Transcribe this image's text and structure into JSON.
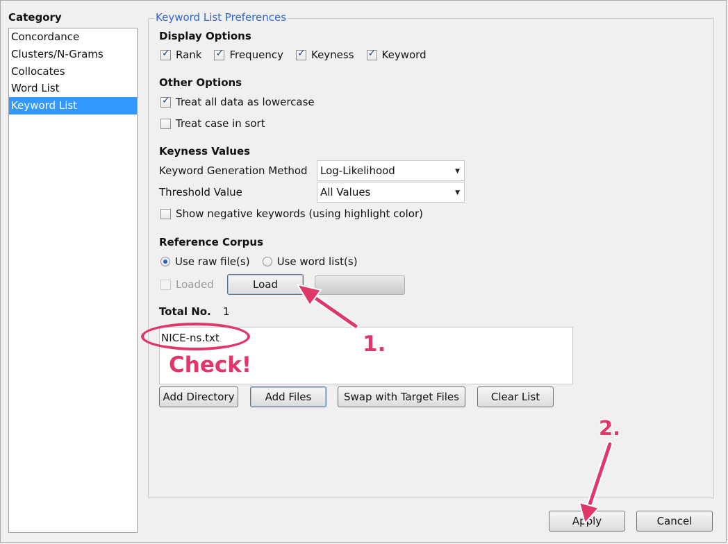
{
  "category": {
    "header": "Category",
    "items": [
      {
        "label": "Concordance",
        "selected": false
      },
      {
        "label": "Clusters/N-Grams",
        "selected": false
      },
      {
        "label": "Collocates",
        "selected": false
      },
      {
        "label": "Word List",
        "selected": false
      },
      {
        "label": "Keyword List",
        "selected": true
      }
    ]
  },
  "panel": {
    "title": "Keyword List Preferences",
    "display_options": {
      "heading": "Display Options",
      "rank": {
        "label": "Rank",
        "checked": true
      },
      "frequency": {
        "label": "Frequency",
        "checked": true
      },
      "keyness": {
        "label": "Keyness",
        "checked": true
      },
      "keyword": {
        "label": "Keyword",
        "checked": true
      }
    },
    "other_options": {
      "heading": "Other Options",
      "lowercase": {
        "label": "Treat all data as lowercase",
        "checked": true
      },
      "case_sort": {
        "label": "Treat case in sort",
        "checked": false
      }
    },
    "keyness_values": {
      "heading": "Keyness Values",
      "method_label": "Keyword Generation Method",
      "method_value": "Log-Likelihood",
      "threshold_label": "Threshold Value",
      "threshold_value": "All Values",
      "negative": {
        "label": "Show negative keywords (using highlight color)",
        "checked": false
      }
    },
    "reference_corpus": {
      "heading": "Reference Corpus",
      "raw_files": {
        "label": "Use raw file(s)",
        "selected": true
      },
      "word_lists": {
        "label": "Use word list(s)",
        "selected": false
      },
      "loaded": {
        "label": "Loaded",
        "checked": false
      },
      "load_button": "Load",
      "total_label": "Total No.",
      "total_value": "1",
      "files": [
        "NICE-ns.txt"
      ],
      "buttons": {
        "add_directory": "Add Directory",
        "add_files": "Add Files",
        "swap": "Swap with Target Files",
        "clear": "Clear List"
      }
    }
  },
  "footer": {
    "apply": "Apply",
    "cancel": "Cancel"
  },
  "annotations": {
    "check": "Check!",
    "step1": "1.",
    "step2": "2.",
    "color": "#e0366a"
  },
  "colors": {
    "selection": "#3399ff",
    "legend_text": "#3366cc"
  }
}
